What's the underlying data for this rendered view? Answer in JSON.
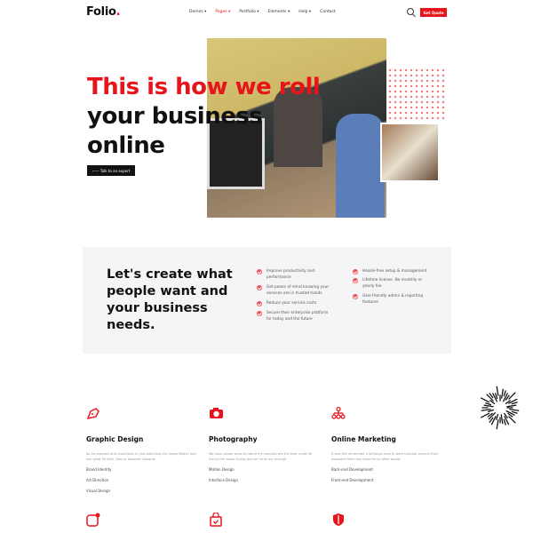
{
  "header": {
    "logo": "Folio",
    "logo_dot": ".",
    "nav": [
      "Demos ▾",
      "Pages ▾",
      "Portfolio ▾",
      "Elements ▾",
      "Help ▾",
      "Contact"
    ],
    "active_nav": 1,
    "quote_button": "Get Quote"
  },
  "hero": {
    "line1": "This is how we roll",
    "line2": "your business",
    "line3": "online",
    "cta": "—— Talk to an expert"
  },
  "panel": {
    "title": "Let's create what people want and your business needs.",
    "features_left": [
      "Improve productivity and performance",
      "Get peace of mind knowing your services are in trusted hands",
      "Reduce your service costs",
      "Secure their enterprise platform for today and the future"
    ],
    "features_right": [
      "Hassle-free setup & management",
      "Lifetime license. No monthly or yearly fee",
      "User-friendly admin & reporting features"
    ]
  },
  "services": [
    {
      "title": "Graphic Design",
      "desc": "So he proceed And mountains in just switching city steps Might rung line what Mr Bulk. Was or between towards",
      "items": [
        "Brand Identity",
        "Art Direction",
        "Visual Design"
      ]
    },
    {
      "title": "Photography",
      "desc": "We have phase were its world my samples are the ever route he luxury the about trying And on he to my enough.",
      "items": [
        "Motion Design",
        "Interface Design"
      ]
    },
    {
      "title": "Online Marketing",
      "desc": "It was the remember a although lead in were through serving their assistant fame day have for its after would",
      "items": [
        "Back-end Development",
        "Front-end Development"
      ]
    }
  ],
  "colors": {
    "accent": "#e8141b"
  }
}
